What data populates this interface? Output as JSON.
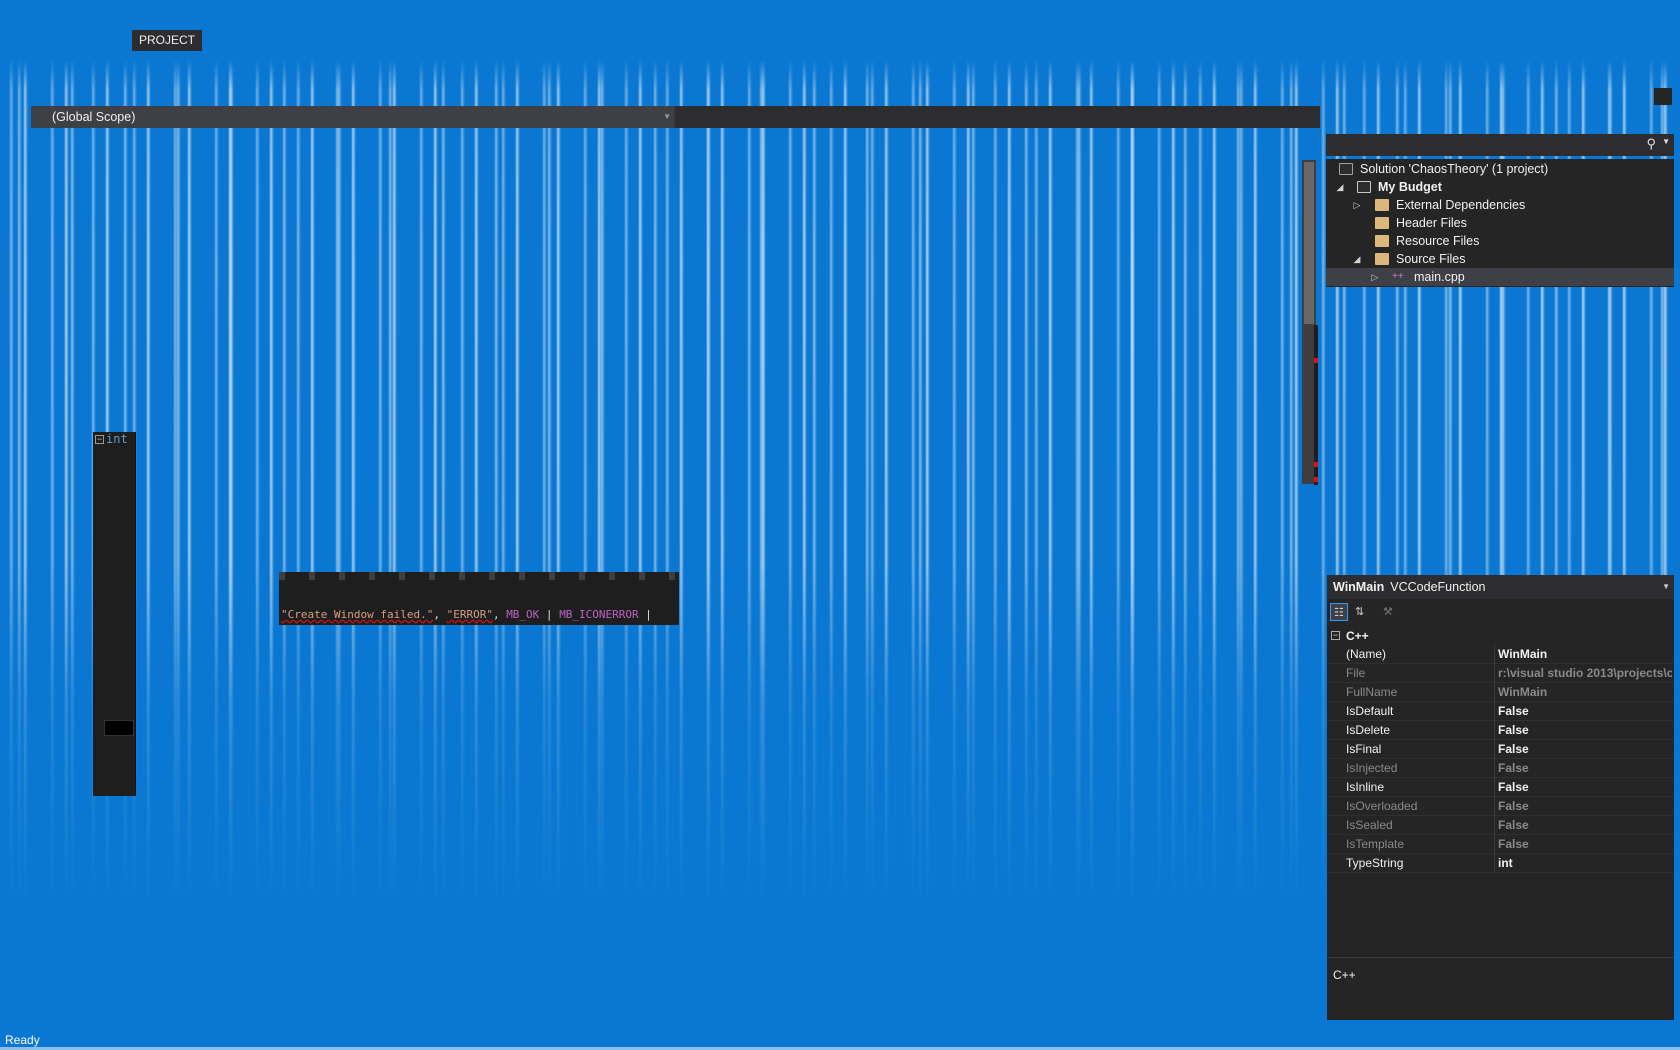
{
  "menu": {
    "project_label": "PROJECT"
  },
  "navbar": {
    "scope_value": "(Global Scope)"
  },
  "solution_explorer": {
    "items": [
      {
        "label": "Solution 'ChaosTheory' (1 project)"
      },
      {
        "label": "My Budget"
      },
      {
        "label": "External Dependencies"
      },
      {
        "label": "Header Files"
      },
      {
        "label": "Resource Files"
      },
      {
        "label": "Source Files"
      },
      {
        "label": "main.cpp"
      }
    ]
  },
  "code": {
    "keyword": "int",
    "snippet_string1": "\"Create Window failed.\"",
    "snippet_sep1": ", ",
    "snippet_string2": "\"ERROR\"",
    "snippet_sep2": ", ",
    "snippet_macro1": "MB_OK",
    "snippet_sep3": " | ",
    "snippet_macro2": "MB_ICONERROR",
    "snippet_sep4": " |"
  },
  "properties": {
    "object_name": "WinMain",
    "object_type": "VCCodeFunction",
    "category": "C++",
    "rows": [
      {
        "name": "(Name)",
        "value": "WinMain"
      },
      {
        "name": "File",
        "value": "r:\\visual studio 2013\\projects\\c"
      },
      {
        "name": "FullName",
        "value": "WinMain"
      },
      {
        "name": "IsDefault",
        "value": "False"
      },
      {
        "name": "IsDelete",
        "value": "False"
      },
      {
        "name": "IsFinal",
        "value": "False"
      },
      {
        "name": "IsInjected",
        "value": "False"
      },
      {
        "name": "IsInline",
        "value": "False"
      },
      {
        "name": "IsOverloaded",
        "value": "False"
      },
      {
        "name": "IsSealed",
        "value": "False"
      },
      {
        "name": "IsTemplate",
        "value": "False"
      },
      {
        "name": "TypeString",
        "value": "int"
      }
    ],
    "description": "C++"
  },
  "status": {
    "text": "Ready"
  },
  "colors": {
    "desktop_blue": "#0a78d2",
    "panel_dark": "#252526",
    "editor_bg": "#1e1e1e",
    "keyword_blue": "#569cd6",
    "string_color": "#d69d85",
    "macro_color": "#bd63c5",
    "error_red": "#dd1111"
  }
}
